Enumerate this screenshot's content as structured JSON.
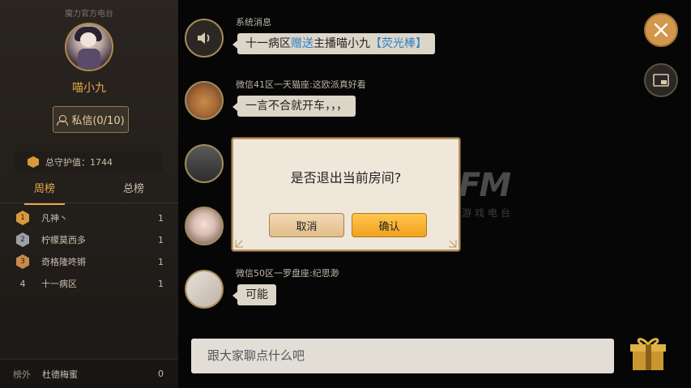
{
  "sidebar": {
    "channel": "魔力官方电台",
    "host_name": "喵小九",
    "pm_button": "私信(0/10)",
    "guard_value": "总守护值：1744",
    "tabs": [
      "周榜",
      "总榜"
    ],
    "ranks": [
      {
        "pos": "1",
        "name": "凡神丶",
        "count": "1",
        "color": "#d89a3a"
      },
      {
        "pos": "2",
        "name": "柠檬莫西多",
        "count": "1",
        "color": "#9aa0a6"
      },
      {
        "pos": "3",
        "name": "奇格隆咚锵",
        "count": "1",
        "color": "#c98a4a"
      },
      {
        "pos": "4",
        "name": "十一病区",
        "count": "1",
        "color": ""
      }
    ],
    "footer": {
      "label": "榜外",
      "name": "杜德梅蜜",
      "count": "0"
    }
  },
  "messages": [
    {
      "sender": "系统消息",
      "bubble_parts": [
        "十一病区",
        "赠送",
        "主播喵小九",
        "【荧光棒】"
      ]
    },
    {
      "sender": "微信41区一天猫座:这欧派真好看",
      "bubble": "一言不合就开车，，，"
    },
    {
      "sender": "",
      "bubble": ""
    },
    {
      "sender": "",
      "bubble": ""
    },
    {
      "sender": "微信50区一罗盘座:纪思渺",
      "bubble": "可能"
    }
  ],
  "watermark": {
    "logo": "FM",
    "sub": "游戏电台"
  },
  "chat_input": {
    "placeholder": "跟大家聊点什么吧"
  },
  "dialog": {
    "question": "是否退出当前房间?",
    "cancel": "取消",
    "confirm": "确认"
  },
  "colors": {
    "accent": "#e6a84a",
    "dialog_bg": "#efe8da",
    "confirm": "#f5a623"
  }
}
